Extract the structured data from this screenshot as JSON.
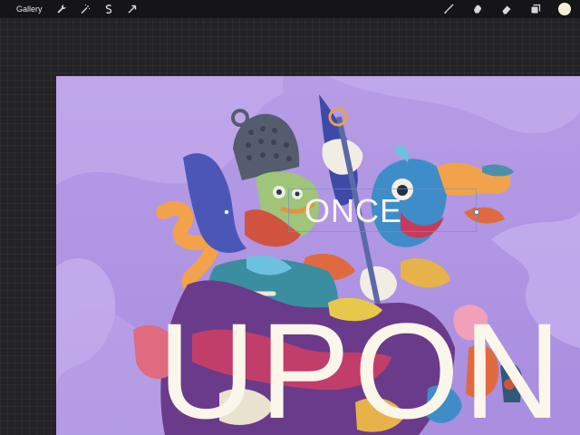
{
  "toolbar": {
    "gallery_label": "Gallery",
    "left_tools": [
      "wrench-icon",
      "magic-wand-icon",
      "selection-icon",
      "transform-icon"
    ],
    "right_tools": [
      "brush-icon",
      "smudge-icon",
      "eraser-icon",
      "layers-icon"
    ],
    "current_color": "#f4efd4"
  },
  "canvas": {
    "text_line_1": "ONCE",
    "text_line_2": "UPON",
    "background_color": "#b79ee6",
    "text_color": "#fbf6ea"
  }
}
